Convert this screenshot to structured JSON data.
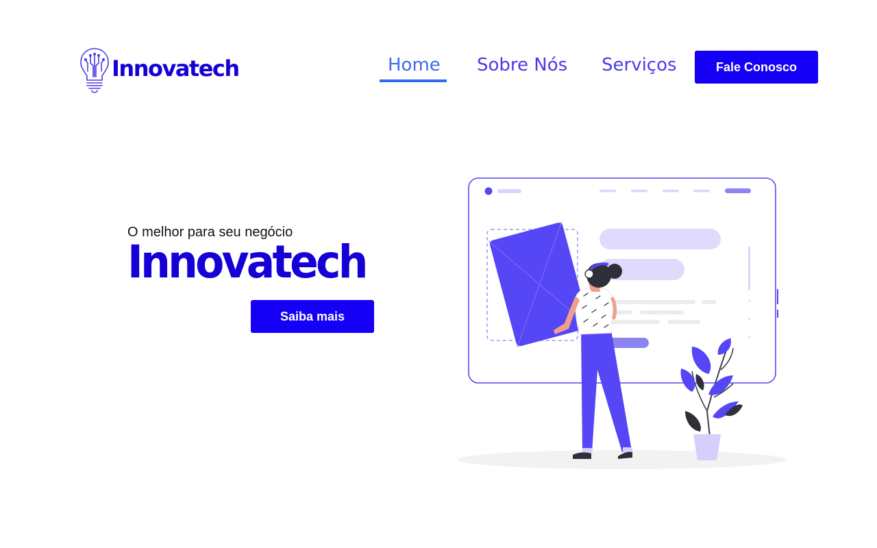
{
  "header": {
    "brand": "Innovatech",
    "logo_icon": "lightbulb-circuit-icon",
    "nav": [
      {
        "label": "Home",
        "active": true
      },
      {
        "label": "Sobre Nós",
        "active": false
      },
      {
        "label": "Serviços",
        "active": false
      }
    ],
    "cta_label": "Fale Conosco"
  },
  "hero": {
    "subtitle": "O melhor para seu negócio",
    "title": "Innovatech",
    "button_label": "Saiba mais",
    "illustration_icon": "woman-building-website-illustration"
  },
  "colors": {
    "brand": "#1500d6",
    "button": "#1500f5",
    "nav": "#4a3aea",
    "nav_active": "#3f6be8",
    "illustration_accent": "#5546f6"
  }
}
